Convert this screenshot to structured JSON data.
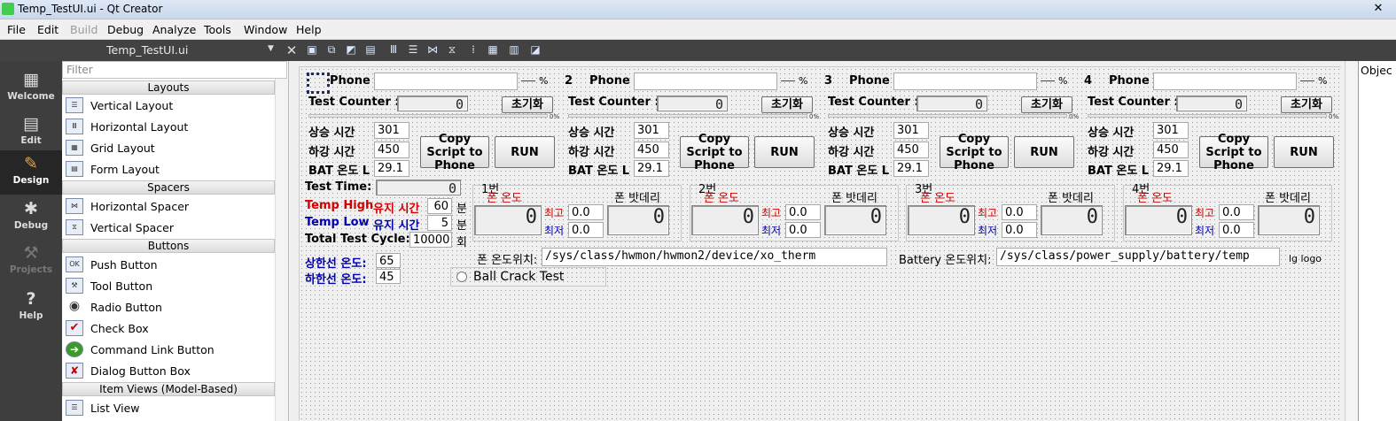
{
  "window": {
    "title": "Temp_TestUI.ui - Qt Creator",
    "close": "✕"
  },
  "menu": [
    "File",
    "Edit",
    "Build",
    "Debug",
    "Analyze",
    "Tools",
    "Window",
    "Help"
  ],
  "editor": {
    "file": "Temp_TestUI.ui",
    "close": "✕"
  },
  "modes": [
    {
      "label": "Welcome",
      "icon": "grid-icon"
    },
    {
      "label": "Edit",
      "icon": "document-icon"
    },
    {
      "label": "Design",
      "icon": "pencil-icon"
    },
    {
      "label": "Debug",
      "icon": "bug-icon"
    },
    {
      "label": "Projects",
      "icon": "wrench-icon"
    },
    {
      "label": "Help",
      "icon": "question-icon"
    }
  ],
  "widgetbox": {
    "filter_placeholder": "Filter",
    "cat_layouts": "Layouts",
    "cat_spacers": "Spacers",
    "cat_buttons": "Buttons",
    "cat_itemviews": "Item Views (Model-Based)",
    "items": [
      "Vertical Layout",
      "Horizontal Layout",
      "Grid Layout",
      "Form Layout",
      "Horizontal Spacer",
      "Vertical Spacer",
      "Push Button",
      "Tool Button",
      "Radio Button",
      "Check Box",
      "Command Link Button",
      "Dialog Button Box",
      "List View"
    ]
  },
  "object_panel": {
    "header": "Objec"
  },
  "form": {
    "panels": [
      {
        "num": "",
        "phone": "Phone",
        "pct": "%",
        "counter_label": "Test Counter :",
        "counter_value": "0",
        "reset": "초기화",
        "progress_pct": "0%",
        "rise_label": "상승 시간",
        "rise": "301",
        "fall_label": "하강 시간",
        "fall": "450",
        "bat_label": "BAT 온도 L",
        "bat": "29.1",
        "copy": "Copy Script to Phone",
        "run": "RUN"
      },
      {
        "num": "2",
        "phone": "Phone",
        "pct": "%",
        "counter_label": "Test Counter :",
        "counter_value": "0",
        "reset": "초기화",
        "progress_pct": "0%",
        "rise_label": "상승 시간",
        "rise": "301",
        "fall_label": "하강 시간",
        "fall": "450",
        "bat_label": "BAT 온도 L",
        "bat": "29.1",
        "copy": "Copy Script to Phone",
        "run": "RUN"
      },
      {
        "num": "3",
        "phone": "Phone",
        "pct": "%",
        "counter_label": "Test Counter :",
        "counter_value": "0",
        "reset": "초기화",
        "progress_pct": "0%",
        "rise_label": "상승 시간",
        "rise": "301",
        "fall_label": "하강 시간",
        "fall": "450",
        "bat_label": "BAT 온도 L",
        "bat": "29.1",
        "copy": "Copy Script to Phone",
        "run": "RUN"
      },
      {
        "num": "4",
        "phone": "Phone",
        "pct": "%",
        "counter_label": "Test Counter :",
        "counter_value": "0",
        "reset": "초기화",
        "progress_pct": "0%",
        "rise_label": "상승 시간",
        "rise": "301",
        "fall_label": "하강 시간",
        "fall": "450",
        "bat_label": "BAT 온도 L",
        "bat": "29.1",
        "copy": "Copy Script to Phone",
        "run": "RUN"
      }
    ],
    "temp_boxes": [
      {
        "title": "1번",
        "phone_temp": "폰 온도",
        "battery": "폰 밧데리",
        "max_label": "최고",
        "min_label": "최저",
        "max": "0.0",
        "min": "0.0",
        "lcd_temp": "0",
        "lcd_bat": "0"
      },
      {
        "title": "2번",
        "phone_temp": "폰 온도",
        "battery": "폰 밧데리",
        "max_label": "최고",
        "min_label": "최저",
        "max": "0.0",
        "min": "0.0",
        "lcd_temp": "0",
        "lcd_bat": "0"
      },
      {
        "title": "3번",
        "phone_temp": "폰 온도",
        "battery": "폰 밧데리",
        "max_label": "최고",
        "min_label": "최저",
        "max": "0.0",
        "min": "0.0",
        "lcd_temp": "0",
        "lcd_bat": "0"
      },
      {
        "title": "4번",
        "phone_temp": "폰 온도",
        "battery": "폰 밧데리",
        "max_label": "최고",
        "min_label": "최저",
        "max": "0.0",
        "min": "0.0",
        "lcd_temp": "0",
        "lcd_bat": "0"
      }
    ],
    "test_time_label": "Test Time:",
    "test_time_value": "0",
    "temp_high_label": "Temp High",
    "temp_high_hold": "유지 시간",
    "temp_high_value": "60",
    "temp_low_label": "Temp Low",
    "temp_low_hold": "유지 시간",
    "temp_low_value": "5",
    "unit_min": "분",
    "cycle_label": "Total Test Cycle:",
    "cycle_value": "10000",
    "unit_times": "회",
    "upper_label": "상한선 온도:",
    "upper_value": "65",
    "lower_label": "하한선 온도:",
    "lower_value": "45",
    "phone_path_label": "폰 온도위치:",
    "phone_path": "/sys/class/hwmon/hwmon2/device/xo_therm",
    "bat_path_label": "Battery 온도위치:",
    "bat_path": "/sys/class/power_supply/battery/temp",
    "logo": "lg logo",
    "ball_crack": "Ball Crack Test"
  }
}
